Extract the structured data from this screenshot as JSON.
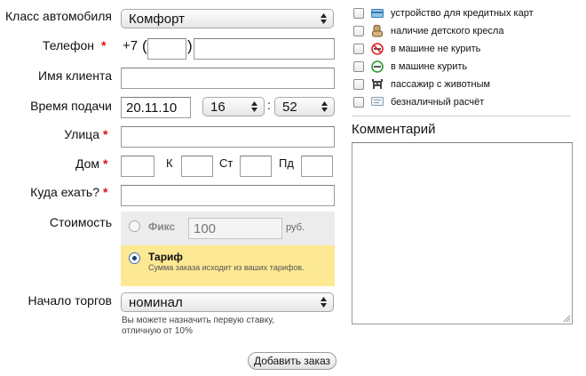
{
  "form": {
    "car_class": {
      "label": "Класс автомобиля",
      "value": "Комфорт"
    },
    "phone": {
      "label": "Телефон",
      "required_mark": "*",
      "prefix": "+7",
      "paren_open": "(",
      "paren_close": ")",
      "code": "",
      "number": ""
    },
    "client_name": {
      "label": "Имя клиента",
      "value": ""
    },
    "pickup_time": {
      "label": "Время подачи",
      "date": "20.11.10",
      "hour": "16",
      "separator": ":",
      "minute": "52"
    },
    "street": {
      "label": "Улица",
      "required_mark": "*",
      "value": ""
    },
    "house": {
      "label": "Дом",
      "required_mark": "*",
      "k_label": "К",
      "st_label": "Ст",
      "pd_label": "Пд"
    },
    "destination": {
      "label": "Куда ехать?",
      "required_mark": "*",
      "value": ""
    },
    "cost": {
      "label": "Стоимость",
      "fixed": {
        "label": "Фикс",
        "placeholder": "100",
        "unit": "руб."
      },
      "tariff": {
        "label": "Тариф",
        "description": "Сумма заказа исходит из ваших тарифов."
      }
    },
    "auction": {
      "label": "Начало торгов",
      "value": "номинал",
      "hint_line1": "Вы можете назначить первую ставку,",
      "hint_line2": "отличную от 10%"
    },
    "submit_label": "Добавить заказ"
  },
  "options": [
    {
      "label": "устройство для кредитных карт",
      "icon": "credit-card-icon"
    },
    {
      "label": "наличие детского кресла",
      "icon": "child-seat-icon"
    },
    {
      "label": "в машине не курить",
      "icon": "no-smoking-icon"
    },
    {
      "label": "в машине курить",
      "icon": "smoking-icon"
    },
    {
      "label": "пассажир с животным",
      "icon": "pet-icon"
    },
    {
      "label": "безналичный расчёт",
      "icon": "cashless-icon"
    }
  ],
  "comment": {
    "label": "Комментарий",
    "value": ""
  },
  "colors": {
    "required": "#dd1111",
    "tariff_bg": "#fde894",
    "cost_bg": "#ececec"
  }
}
